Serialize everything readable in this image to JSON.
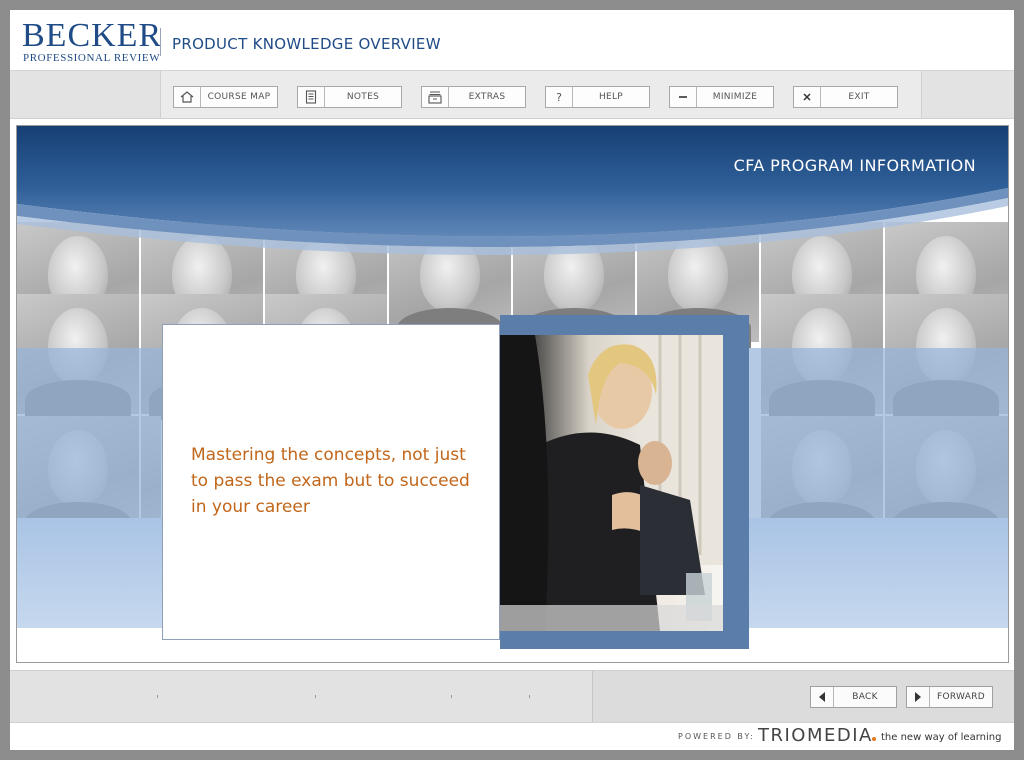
{
  "header": {
    "logo_main": "BECKER",
    "logo_sub": "PROFESSIONAL REVIEW",
    "course_title": "PRODUCT KNOWLEDGE OVERVIEW"
  },
  "toolbar": {
    "course_map": "COURSE MAP",
    "notes": "NOTES",
    "extras": "EXTRAS",
    "help": "HELP",
    "minimize": "MINIMIZE",
    "exit": "EXIT"
  },
  "slide": {
    "section_title": "CFA PROGRAM INFORMATION",
    "headline": "Mastering the concepts, not just to pass the exam but to succeed in your career"
  },
  "nav": {
    "back": "BACK",
    "forward": "FORWARD"
  },
  "footer": {
    "powered_by": "POWERED BY:",
    "brand": "TRIOMEDIA",
    "tagline": "the new way of learning"
  },
  "colors": {
    "brand_blue": "#1f4b86",
    "banner_blue": "#1d4a80",
    "accent_orange": "#c1661a",
    "frame_blue": "#5a7ea9"
  }
}
